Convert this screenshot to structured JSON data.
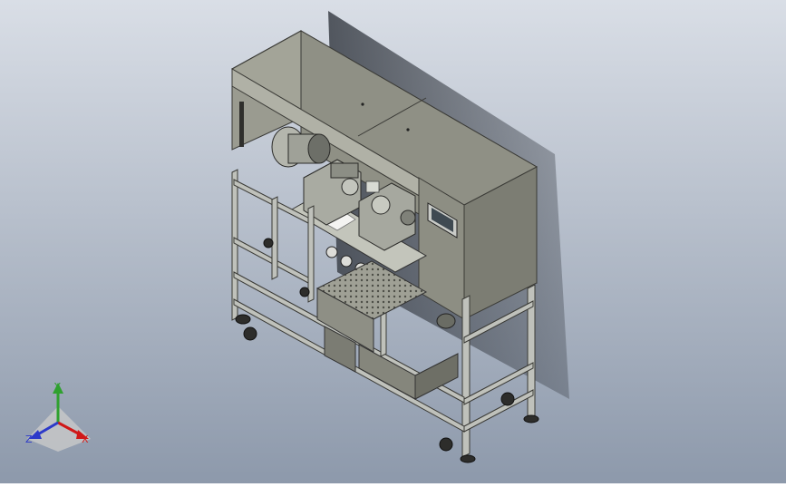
{
  "viewport": {
    "background_top": "#d9dee6",
    "background_bottom": "#8d99ab"
  },
  "model": {
    "frame_color": "#b9bcb9",
    "panel_color": "#8a8b7f",
    "panel_dark": "#6f7066",
    "shadow_color": "#4a4f57"
  },
  "triad": {
    "x_label": "X",
    "y_label": "Y",
    "z_label": "Z",
    "x_color": "#d01818",
    "y_color": "#2fa12f",
    "z_color": "#2c39c9"
  }
}
